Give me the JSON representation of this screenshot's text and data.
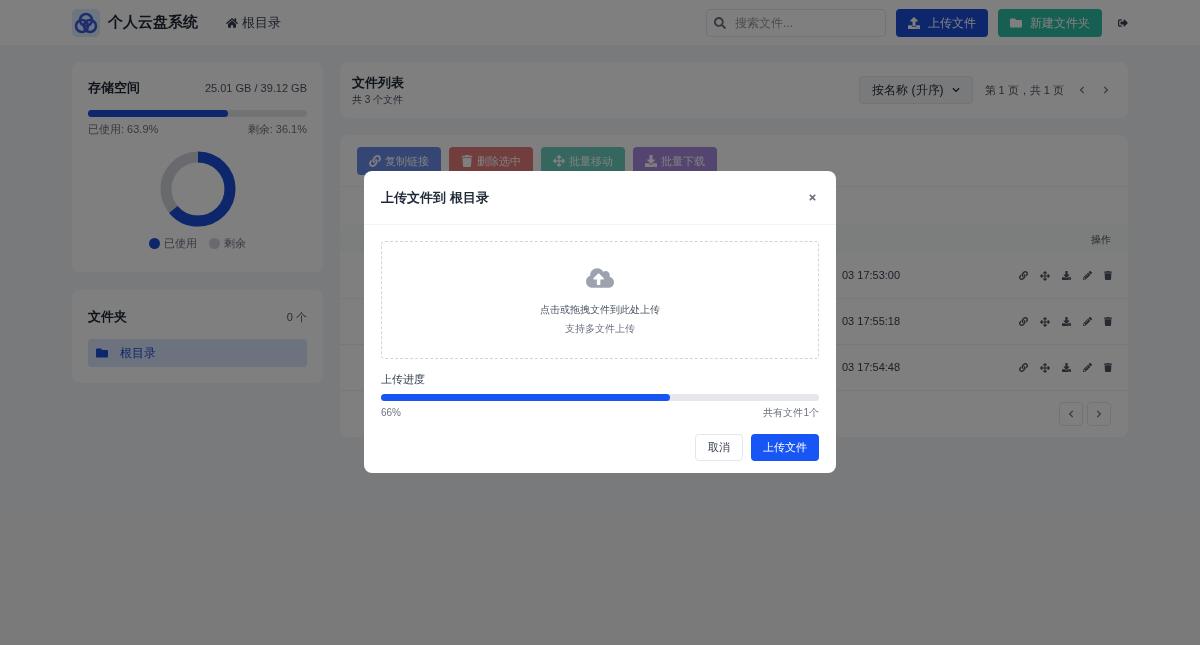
{
  "header": {
    "app_name": "个人云盘系统",
    "breadcrumb": "根目录",
    "search": {
      "placeholder": "搜索文件..."
    },
    "buttons": [
      {
        "label": "上传文件",
        "kind": "upload"
      },
      {
        "label": "新建文件夹",
        "kind": "folder"
      }
    ]
  },
  "storage": {
    "title": "存储空间",
    "usage": "25.01 GB / 39.12 GB",
    "level": 0.639,
    "used_label": "已使用: 63.9%",
    "remaining_label": "剩余: 36.1%",
    "legend": [
      {
        "label": "已使用",
        "kind": "used"
      },
      {
        "label": "剩余",
        "kind": "remaining"
      }
    ]
  },
  "folders": {
    "title": "文件夹",
    "count": "0 个",
    "items": [
      {
        "label": "根目录",
        "selected": true
      }
    ]
  },
  "file_list": {
    "title": "文件列表",
    "subtitle": "共 3 个文件",
    "sort": "按名称 (升序)",
    "page_info": "第 1 页，共 1 页"
  },
  "batch_buttons": [
    {
      "label": "复制链接",
      "kind": "link"
    },
    {
      "label": "删除选中",
      "kind": "delete"
    },
    {
      "label": "批量移动",
      "kind": "move"
    },
    {
      "label": "批量下载",
      "kind": "download"
    }
  ],
  "table": {
    "actions_header": "操作",
    "rows": [
      {
        "time": "03 17:53:00"
      },
      {
        "time": "03 17:55:18"
      },
      {
        "time": "03 17:54:48"
      }
    ]
  },
  "modal": {
    "title": "上传文件到 根目录",
    "drop_text": "点击或拖拽文件到此处上传",
    "drop_hint": "支持多文件上传",
    "progress_label": "上传进度",
    "level": 0.66,
    "percent": "66%",
    "file_count": "共有文件1个",
    "cancel": "取消",
    "submit": "上传文件"
  }
}
